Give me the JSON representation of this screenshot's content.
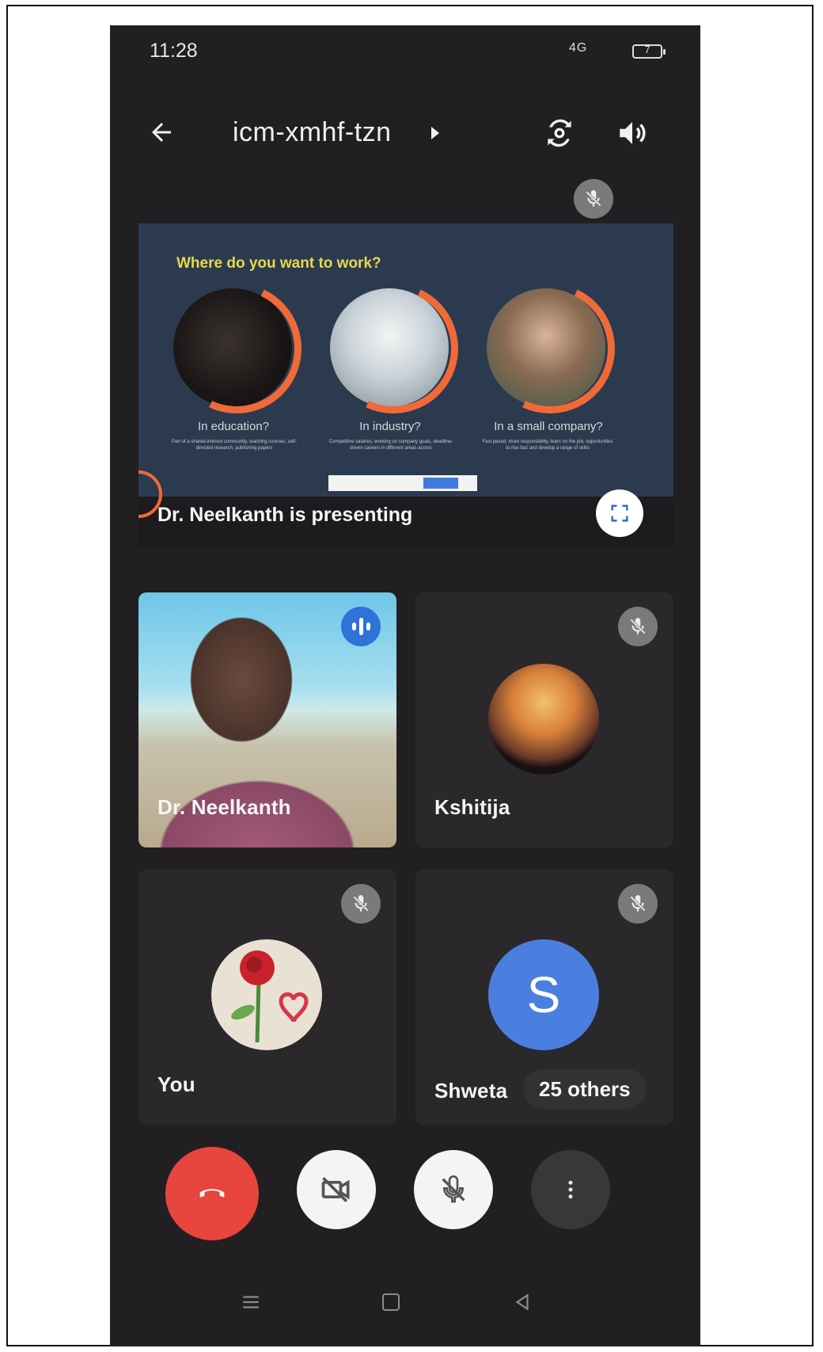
{
  "status": {
    "time": "11:28",
    "signal": "4G",
    "battery": "7"
  },
  "header": {
    "meeting_code": "icm-xmhf-tzn"
  },
  "presentation": {
    "slide_title": "Where do you want to work?",
    "options": [
      {
        "caption": "In education?",
        "sub": "Part of a shared-interest community, teaching courses, self-directed research, publishing papers"
      },
      {
        "caption": "In industry?",
        "sub": "Competitive salaries, working on company goals, deadline-driven careers in different areas across"
      },
      {
        "caption": "In a small company?",
        "sub": "Fast paced, more responsibility, learn on the job, opportunities to rise fast and develop a range of skills"
      }
    ],
    "label": "Dr. Neelkanth is presenting"
  },
  "participants": {
    "p1": {
      "name": "Dr. Neelkanth"
    },
    "p2": {
      "name": "Kshitija"
    },
    "p3": {
      "name": "You"
    },
    "p4": {
      "name": "Shweta",
      "initial": "S",
      "others": "25 others"
    }
  },
  "colors": {
    "end_call": "#e8453e",
    "speaking": "#2f72d8",
    "accent_orange": "#f06a38",
    "slide_title": "#e9d84a"
  },
  "icons": [
    "back-arrow-icon",
    "flip-camera-icon",
    "speaker-icon",
    "mic-off-icon",
    "fullscreen-icon",
    "speaking-icon",
    "end-call-icon",
    "camera-off-icon",
    "more-vert-icon"
  ]
}
